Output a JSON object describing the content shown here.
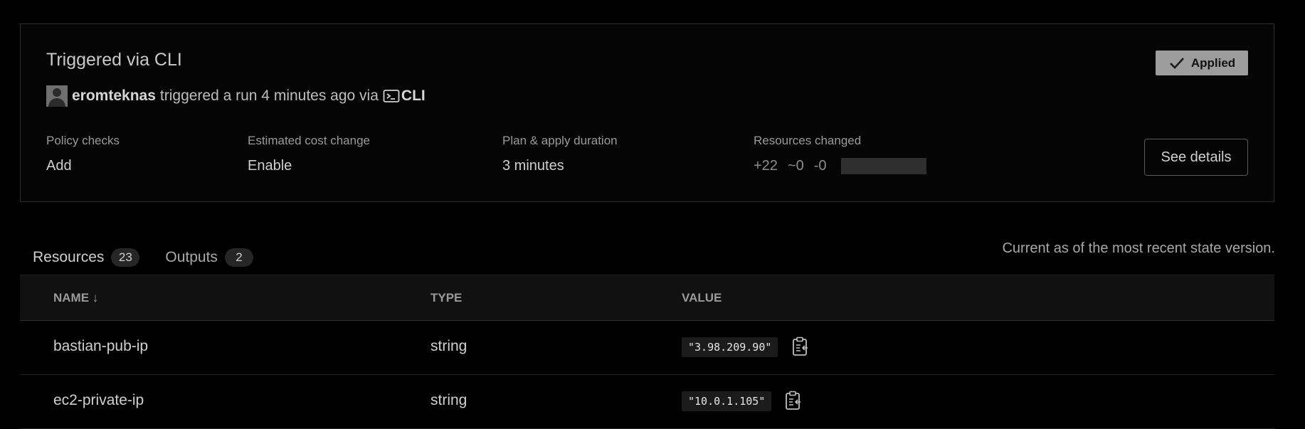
{
  "run": {
    "title": "Triggered via CLI",
    "status_label": "Applied",
    "user": "eromteknas",
    "trigger_text": "triggered a run 4 minutes ago via",
    "via": "CLI"
  },
  "metrics": {
    "policy_checks": {
      "label": "Policy checks",
      "value": "Add"
    },
    "cost_change": {
      "label": "Estimated cost change",
      "value": "Enable"
    },
    "duration": {
      "label": "Plan & apply duration",
      "value": "3 minutes"
    },
    "resources_changed": {
      "label": "Resources changed",
      "added": "+22",
      "changed": "~0",
      "destroyed": "-0"
    }
  },
  "see_details_label": "See details",
  "tabs": [
    {
      "label": "Resources",
      "count": "23"
    },
    {
      "label": "Outputs",
      "count": "2"
    }
  ],
  "state_note": "Current as of the most recent state version.",
  "table": {
    "headers": {
      "name": "NAME ↓",
      "type": "TYPE",
      "value": "VALUE"
    },
    "rows": [
      {
        "name": "bastian-pub-ip",
        "type": "string",
        "value": "\"3.98.209.90\""
      },
      {
        "name": "ec2-private-ip",
        "type": "string",
        "value": "\"10.0.1.105\""
      }
    ]
  },
  "icons": {
    "status": "check-icon",
    "avatar": "user-avatar",
    "via": "terminal-icon",
    "copy": "clipboard-copy-icon"
  }
}
